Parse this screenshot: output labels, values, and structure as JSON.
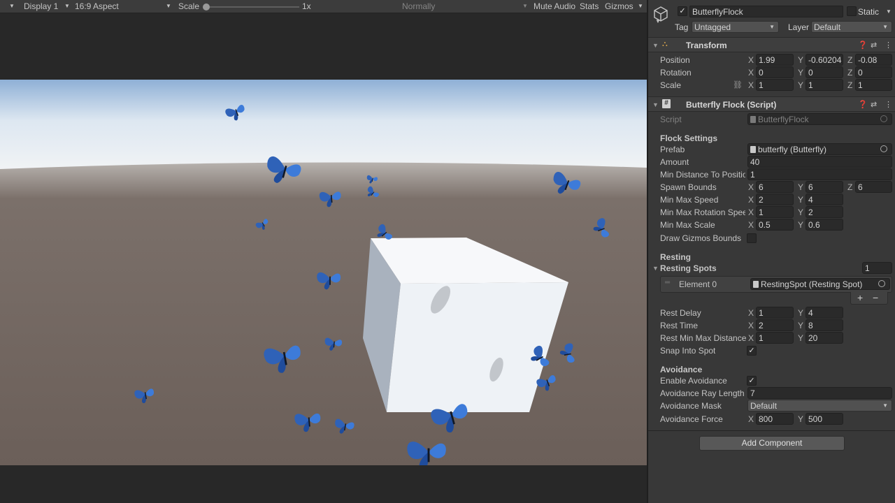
{
  "toolbar": {
    "display": "Display 1",
    "aspect": "16:9 Aspect",
    "scale_label": "Scale",
    "scale_value": "1x",
    "play_focus": "Normally",
    "mute_audio": "Mute Audio",
    "stats": "Stats",
    "gizmos": "Gizmos"
  },
  "inspector": {
    "object_name": "ButterflyFlock",
    "static_label": "Static",
    "tag_label": "Tag",
    "tag_value": "Untagged",
    "layer_label": "Layer",
    "layer_value": "Default",
    "transform": {
      "title": "Transform",
      "position_label": "Position",
      "rotation_label": "Rotation",
      "scale_label": "Scale",
      "position": [
        "1.99",
        "-0.60204",
        "-0.08"
      ],
      "rotation": [
        "0",
        "0",
        "0"
      ],
      "scale": [
        "1",
        "1",
        "1"
      ]
    },
    "script_comp": {
      "title": "Butterfly Flock (Script)",
      "script_label": "Script",
      "script_value": "ButterflyFlock",
      "flock_settings": "Flock Settings",
      "prefab_label": "Prefab",
      "prefab_value": "butterfly (Butterfly)",
      "amount_label": "Amount",
      "amount_value": "40",
      "min_distance_label": "Min Distance To Positio",
      "min_distance_value": "1",
      "spawn_bounds_label": "Spawn Bounds",
      "spawn_bounds": [
        "6",
        "6",
        "6"
      ],
      "min_max_speed_label": "Min Max Speed",
      "min_max_speed": [
        "2",
        "4"
      ],
      "min_max_rot_label": "Min Max Rotation Speec",
      "min_max_rot": [
        "1",
        "2"
      ],
      "min_max_scale_label": "Min Max Scale",
      "min_max_scale": [
        "0.5",
        "0.6"
      ],
      "draw_gizmos_label": "Draw Gizmos Bounds",
      "resting": "Resting",
      "resting_spots_label": "Resting Spots",
      "resting_spots_count": "1",
      "element0_label": "Element 0",
      "element0_value": "RestingSpot (Resting Spot)",
      "rest_delay_label": "Rest Delay",
      "rest_delay": [
        "1",
        "4"
      ],
      "rest_time_label": "Rest Time",
      "rest_time": [
        "2",
        "8"
      ],
      "rest_minmax_label": "Rest Min Max Distance",
      "rest_minmax": [
        "1",
        "20"
      ],
      "snap_label": "Snap Into Spot",
      "avoidance": "Avoidance",
      "enable_avoid_label": "Enable Avoidance",
      "ray_length_label": "Avoidance Ray Length",
      "ray_length_value": "7",
      "mask_label": "Avoidance Mask",
      "mask_value": "Default",
      "force_label": "Avoidance Force",
      "force": [
        "800",
        "500"
      ]
    },
    "add_component": "Add Component"
  },
  "axes": {
    "x": "X",
    "y": "Y",
    "z": "Z"
  },
  "colors": {
    "accent": "#3d7bd9",
    "sky": "#dfe9f3",
    "ground": "#6e625c",
    "cube": "#f2f5f8"
  }
}
